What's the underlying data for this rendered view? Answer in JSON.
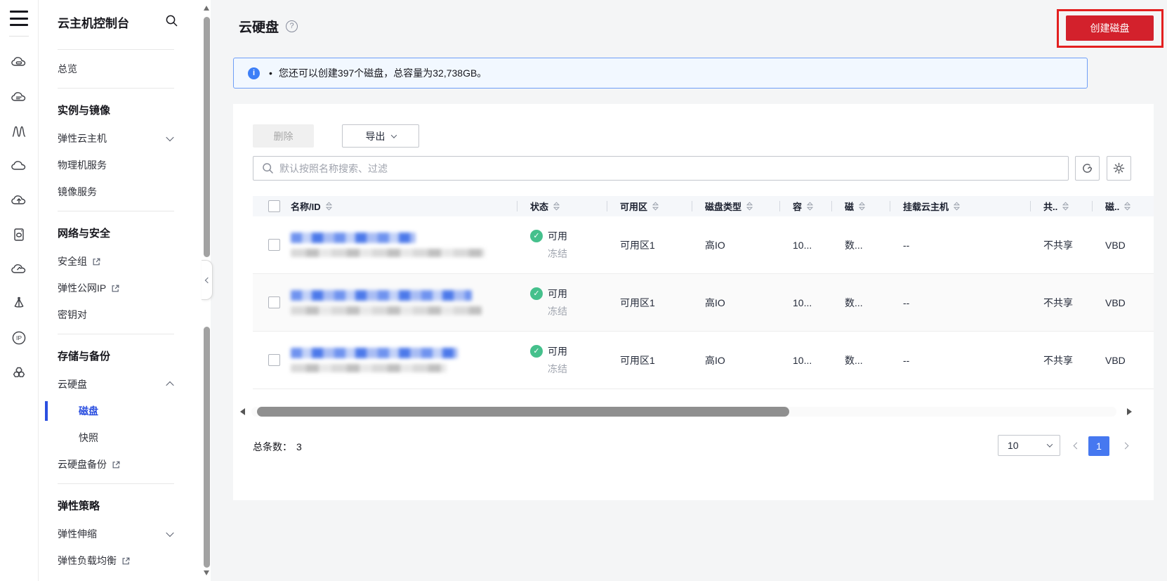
{
  "app": {
    "console_title": "云主机控制台"
  },
  "icon_rail": {
    "icons": [
      "menu",
      "cloud-server",
      "cloud-stack",
      "autoscaling-waves",
      "cloud",
      "cloud-upload",
      "disk-server",
      "cloud-flag",
      "beacon",
      "ip",
      "hex-cluster"
    ]
  },
  "sidebar": {
    "groups": [
      {
        "header": "",
        "items": [
          {
            "label": "总览"
          }
        ]
      },
      {
        "header": "实例与镜像",
        "items": [
          {
            "label": "弹性云主机"
          },
          {
            "label": "物理机服务"
          },
          {
            "label": "镜像服务"
          }
        ]
      },
      {
        "header": "网络与安全",
        "items": [
          {
            "label": "安全组"
          },
          {
            "label": "弹性公网IP"
          },
          {
            "label": "密钥对"
          }
        ]
      },
      {
        "header": "存储与备份",
        "items": [
          {
            "label": "云硬盘"
          },
          {
            "label": "磁盘"
          },
          {
            "label": "快照"
          },
          {
            "label": "云硬盘备份"
          }
        ]
      },
      {
        "header": "弹性策略",
        "items": [
          {
            "label": "弹性伸缩"
          },
          {
            "label": "弹性负载均衡"
          }
        ]
      }
    ]
  },
  "page_header": {
    "title": "云硬盘",
    "help_icon": "?",
    "create_button_label": "创建磁盘"
  },
  "banner": {
    "bullet": "•",
    "message": "您还可以创建397个磁盘，总容量为32,738GB。",
    "info_icon": "i"
  },
  "toolbar": {
    "delete_label": "删除",
    "export_label": "导出",
    "search_placeholder": "默认按照名称搜索、过滤"
  },
  "table": {
    "columns": [
      "名称/ID",
      "状态",
      "可用区",
      "磁盘类型",
      "容",
      "磁",
      "挂载云主机",
      "共..",
      "磁.."
    ],
    "rows": [
      {
        "status": "可用",
        "sub_status": "冻结",
        "az": "可用区1",
        "disk_type": "高IO",
        "capacity": "10...",
        "attribute": "数...",
        "attached_host": "--",
        "sharing": "不共享",
        "mode": "VBD"
      },
      {
        "status": "可用",
        "sub_status": "冻结",
        "az": "可用区1",
        "disk_type": "高IO",
        "capacity": "10...",
        "attribute": "数...",
        "attached_host": "--",
        "sharing": "不共享",
        "mode": "VBD"
      },
      {
        "status": "可用",
        "sub_status": "冻结",
        "az": "可用区1",
        "disk_type": "高IO",
        "capacity": "10...",
        "attribute": "数...",
        "attached_host": "--",
        "sharing": "不共享",
        "mode": "VBD"
      }
    ]
  },
  "pagination": {
    "total_label": "总条数：",
    "total": "3",
    "page_size": "10",
    "current_page": "1"
  },
  "colors": {
    "accent_blue": "#2b4fe0",
    "pagination_active_blue": "#4678f0",
    "brand_red": "#d3212c",
    "annotation_red": "#e32020",
    "success_green": "#45c08c",
    "banner_border": "#6e9ef7",
    "banner_bg": "#f2f8ff"
  }
}
